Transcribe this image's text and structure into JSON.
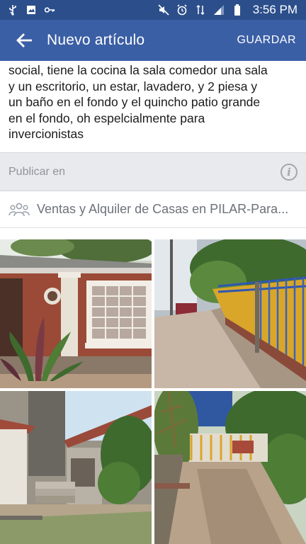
{
  "status_bar": {
    "time": "3:56 PM",
    "left_icons": [
      "usb-icon",
      "gallery-icon",
      "key-icon"
    ],
    "right_icons": [
      "mute-icon",
      "alarm-icon",
      "network-icon",
      "signal-icon",
      "battery-icon"
    ]
  },
  "app_bar": {
    "title": "Nuevo artículo",
    "save_label": "GUARDAR",
    "back_icon": "arrow-left-icon",
    "color": "#3b5fa5"
  },
  "post": {
    "lines": [
      "social, tiene la cocina la sala comedor una sala",
      "y un escritorio, un estar, lavadero,  y 2 piesa y",
      "un  baño en el fondo y el quincho patio grande",
      "en el fondo, oh espelcialmente para",
      "invercionistas"
    ]
  },
  "publish": {
    "label": "Publicar en",
    "info_icon": "info-icon",
    "group_icon": "group-icon",
    "group_name": "Ventas y Alquiler de Casas en PILAR-Para..."
  },
  "photos": [
    {
      "name": "photo-house-front"
    },
    {
      "name": "photo-street-fence"
    },
    {
      "name": "photo-backyard-wall"
    },
    {
      "name": "photo-garden-path"
    }
  ]
}
